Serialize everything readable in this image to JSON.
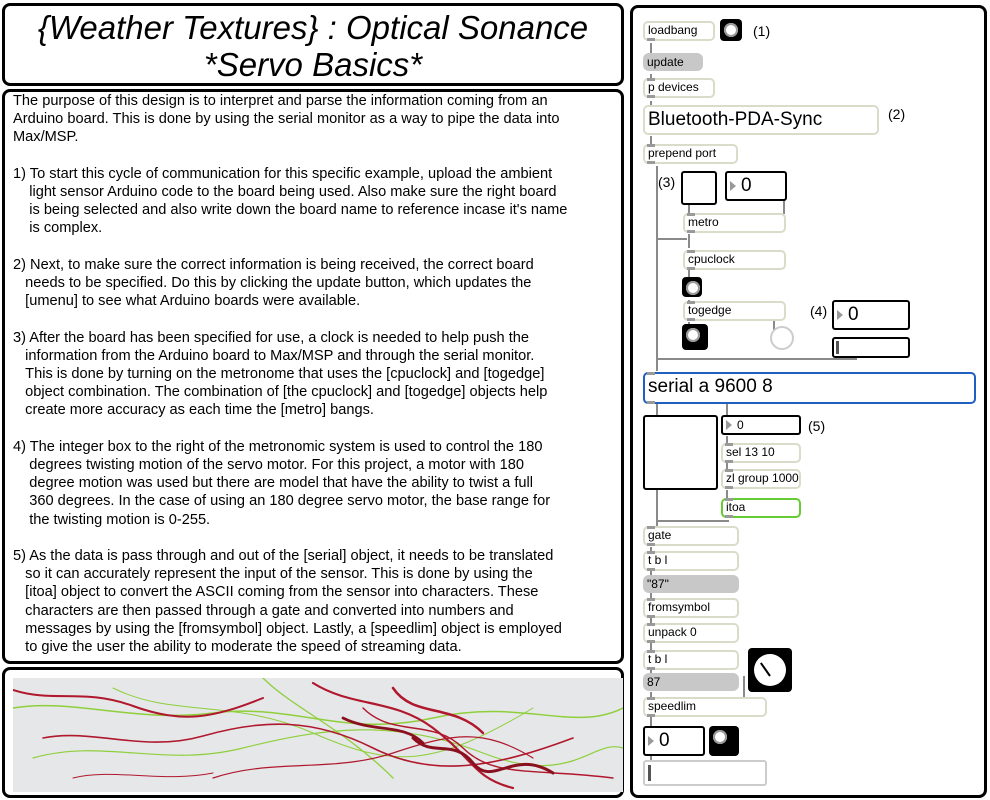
{
  "title": {
    "line1": "{Weather Textures} : Optical Sonance",
    "line2": "*Servo Basics*"
  },
  "description": "The purpose of this design is to interpret and parse the information coming from an\nArduino board. This is done by using the serial monitor as a way to pipe the data into\nMax/MSP.\n\n1) To start this cycle of communication for this specific example, upload the ambient\n    light sensor Arduino code to the board being used. Also make sure the right board\n    is being selected and also write down the board name to reference incase it's name\n    is complex.\n\n2) Next, to make sure the correct information is being received, the correct board\n   needs to be specified. Do this by clicking the update button, which updates the\n   [umenu] to see what Arduino boards were available.\n\n3) After the board has been specified for use, a clock is needed to help push the\n   information from the Arduino board to Max/MSP and through the serial monitor.\n   This is done by turning on the metronome that uses the [cpuclock] and [togedge]\n   object combination. The combination of [the cpuclock] and [togedge] objects help\n   create more accuracy as each time the [metro] bangs.\n\n4) The integer box to the right of the metronomic system is used to control the 180\n    degrees twisting motion of the servo motor. For this project, a motor with 180\n    degree motion was used but there are model that have the ability to twist a full\n    360 degrees. In the case of using an 180 degree servo motor, the base range for\n    the twisting motion is 0-255.\n\n5) As the data is pass through and out of the [serial] object, it needs to be translated\n   so it can accurately represent the input of the sensor. This is done by using the\n   [itoa] object to convert the ASCII coming from the sensor into characters. These\n   characters are then passed through a gate and converted into numbers and\n   messages by using the [fromsymbol] object. Lastly, a [speedlim] object is employed\n   to give the user the ability to moderate the speed of streaming data.",
  "patch": {
    "loadbang": "loadbang",
    "label1": "(1)",
    "update": "update",
    "p_devices": "p devices",
    "umenu_value": "Bluetooth-PDA-Sync",
    "label2": "(2)",
    "prepend_port": "prepend port",
    "label3": "(3)",
    "metro_rate": "0",
    "metro": "metro",
    "cpuclock": "cpuclock",
    "togedge": "togedge",
    "label4": "(4)",
    "servo_value": "0",
    "serial": "serial a 9600 8",
    "num5": "0",
    "label5": "(5)",
    "sel": "sel 13 10",
    "zl_group": "zl group 1000",
    "itoa": "itoa",
    "gate": "gate",
    "tbl1": "t b l",
    "msg87_str": "\"87\"",
    "fromsymbol": "fromsymbol",
    "unpack": "unpack 0",
    "tbl2": "t b l",
    "msg87": "87",
    "speedlim": "speedlim",
    "final_num": "0"
  },
  "colors": {
    "object_border": "#d9dcc8",
    "serial_border": "#1f5fbf",
    "itoa_border": "#66cc33",
    "message_bg": "#c8c8c8",
    "photo_red": "#b0182e",
    "photo_green": "#8fcf3c"
  }
}
